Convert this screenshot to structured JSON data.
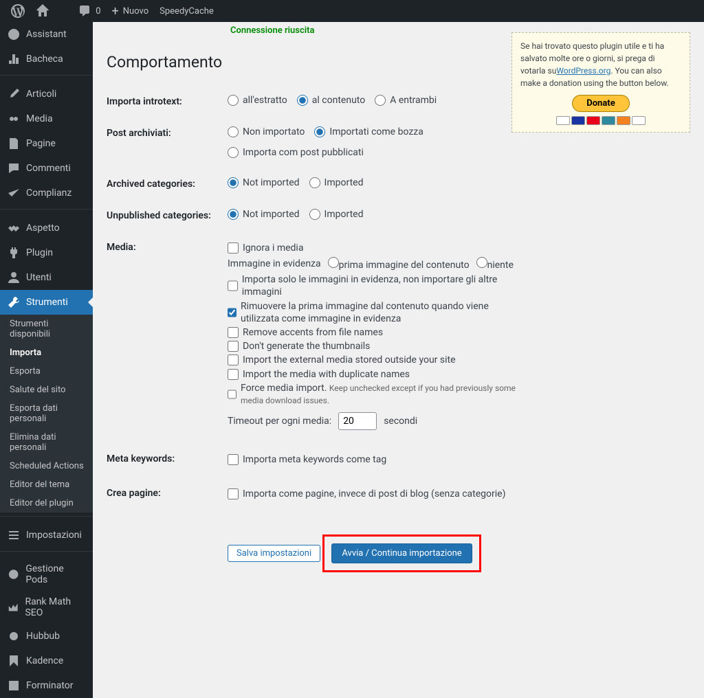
{
  "topbar": {
    "comments_count": "0",
    "new_label": "Nuovo",
    "speedy": "SpeedyCache"
  },
  "sidebar": {
    "items": [
      {
        "label": "Assistant"
      },
      {
        "label": "Bacheca"
      },
      {
        "label": "Articoli"
      },
      {
        "label": "Media"
      },
      {
        "label": "Pagine"
      },
      {
        "label": "Commenti"
      },
      {
        "label": "Complianz"
      },
      {
        "label": "Aspetto"
      },
      {
        "label": "Plugin"
      },
      {
        "label": "Utenti"
      },
      {
        "label": "Strumenti"
      }
    ],
    "sub": [
      {
        "label": "Strumenti disponibili"
      },
      {
        "label": "Importa"
      },
      {
        "label": "Esporta"
      },
      {
        "label": "Salute del sito"
      },
      {
        "label": "Esporta dati personali"
      },
      {
        "label": "Elimina dati personali"
      },
      {
        "label": "Scheduled Actions"
      },
      {
        "label": "Editor del tema"
      },
      {
        "label": "Editor del plugin"
      }
    ],
    "after": [
      {
        "label": "Impostazioni"
      },
      {
        "label": "Gestione Pods"
      },
      {
        "label": "Rank Math SEO"
      },
      {
        "label": "Hubbub"
      },
      {
        "label": "Kadence"
      },
      {
        "label": "Forminator"
      }
    ]
  },
  "status_text": "Connessione riuscita",
  "donate": {
    "text1": "Se hai trovato questo plugin utile e ti ha salvato molte ore o giorni, si prega di votarla su",
    "link": "WordPress.org",
    "text2": ". You can also make a donation using the button below.",
    "btn": "Donate"
  },
  "section_title": "Comportamento",
  "rows": {
    "introtext": {
      "label": "Importa introtext:",
      "opts": [
        "all'estratto",
        "al contenuto",
        "A entrambi"
      ]
    },
    "archived": {
      "label": "Post archiviati:",
      "opts": [
        "Non importato",
        "Importati come bozza",
        "Importa com post pubblicati"
      ]
    },
    "arch_cat": {
      "label": "Archived categories:",
      "opts": [
        "Not imported",
        "Imported"
      ]
    },
    "unpub_cat": {
      "label": "Unpublished categories:",
      "opts": [
        "Not imported",
        "Imported"
      ]
    },
    "media": {
      "label": "Media:",
      "ignore": "Ignora i media",
      "featured_lbl": "Immagine in evidenza",
      "featured_opts": [
        "prima immagine del contenuto",
        "niente"
      ],
      "only_featured": "Importa solo le immagini in evidenza, non importare gli altre immagini",
      "remove_first": "Rimuovere la prima immagine dal contenuto quando viene utilizzata come immagine in evidenza",
      "accents": "Remove accents from file names",
      "thumbs": "Don't generate the thumbnails",
      "external": "Import the external media stored outside your site",
      "dup": "Import the media with duplicate names",
      "force": "Force media import.",
      "force_hint": "Keep unchecked except if you had previously some media download issues.",
      "timeout_lbl": "Timeout per ogni media:",
      "timeout_val": "20",
      "timeout_unit": "secondi"
    },
    "keywords": {
      "label": "Meta keywords:",
      "opt": "Importa meta keywords come tag"
    },
    "pages": {
      "label": "Crea pagine:",
      "opt": "Importa come pagine, invece di post di blog (senza categorie)"
    }
  },
  "buttons": {
    "save": "Salva impostazioni",
    "start": "Avvia / Continua importazione"
  }
}
